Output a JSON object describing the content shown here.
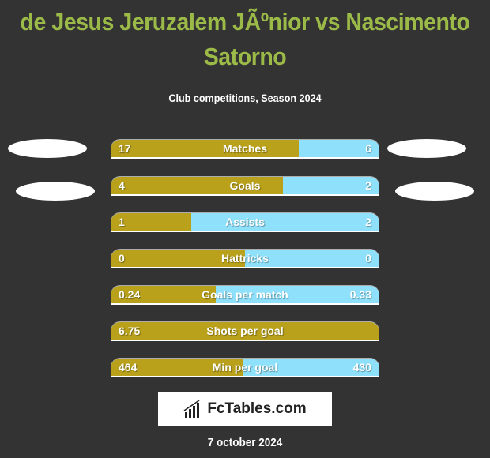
{
  "header": {
    "title_line1": "de Jesus Jeruzalem JÃºnior vs Nascimento",
    "title_line2": "Satorno",
    "subtitle": "Club competitions, Season 2024"
  },
  "colors": {
    "left": "#b9a11b",
    "right": "#8fe1fb",
    "title": "#9cba48",
    "background": "#333333"
  },
  "chart_data": {
    "type": "bar",
    "title": "de Jesus Jeruzalem JÃºnior vs Nascimento Satorno",
    "subtitle": "Club competitions, Season 2024",
    "categories": [
      "Matches",
      "Goals",
      "Assists",
      "Hattricks",
      "Goals per match",
      "Shots per goal",
      "Min per goal"
    ],
    "series": [
      {
        "name": "de Jesus Jeruzalem JÃºnior",
        "values": [
          17,
          4,
          1,
          0,
          0.24,
          6.75,
          464
        ],
        "labels": [
          "17",
          "4",
          "1",
          "0",
          "0.24",
          "6.75",
          "464"
        ]
      },
      {
        "name": "Nascimento Satorno",
        "values": [
          6,
          2,
          2,
          0,
          0.33,
          0,
          430
        ],
        "labels": [
          "6",
          "2",
          "2",
          "0",
          "0.33",
          "",
          "430"
        ]
      }
    ],
    "left_share": [
      0.7,
      0.64,
      0.3,
      0.5,
      0.39,
      1.0,
      0.49
    ]
  },
  "logo": {
    "text": "FcTables.com",
    "icon": "bar-chart-icon"
  },
  "footer": {
    "date": "7 october 2024"
  }
}
